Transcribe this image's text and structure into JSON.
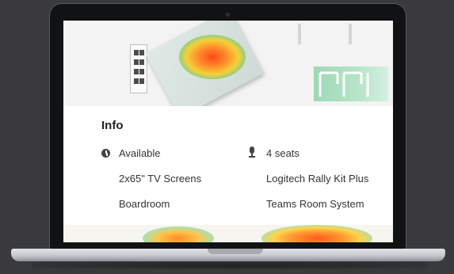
{
  "info": {
    "title": "Info",
    "availability": "Available",
    "seats": "4 seats",
    "display": "2x65\" TV Screens",
    "video_kit": "Logitech Rally Kit Plus",
    "room_type": "Boardroom",
    "room_system": "Teams Room System"
  },
  "icons": {
    "availability": "clock-icon",
    "seats": "mic-icon"
  },
  "colors": {
    "heat_hot": "#ff4a1c",
    "heat_warm": "#ff8a2a",
    "heat_mid": "#f6d03a",
    "heat_cool": "#5ac878",
    "device_bezel": "#111214",
    "background": "#3a3a3c"
  }
}
